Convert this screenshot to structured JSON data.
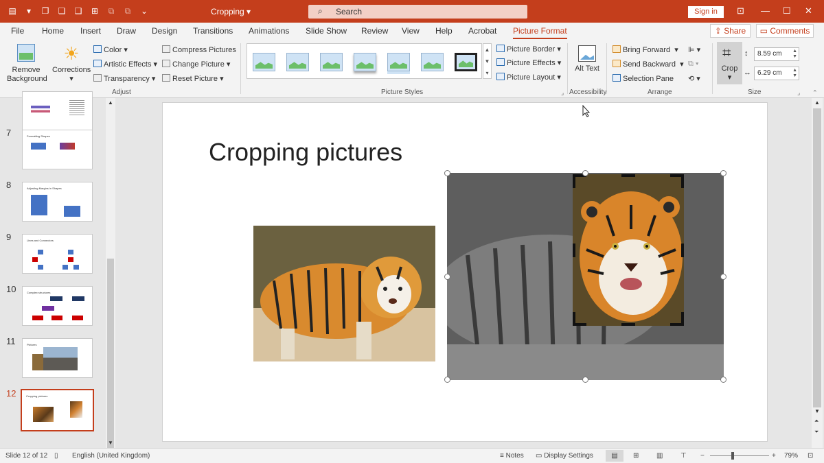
{
  "window": {
    "doc_title": "Cropping",
    "search_placeholder": "Search",
    "sign_in": "Sign in"
  },
  "tabs": [
    "File",
    "Home",
    "Insert",
    "Draw",
    "Design",
    "Transitions",
    "Animations",
    "Slide Show",
    "Review",
    "View",
    "Help",
    "Acrobat",
    "Picture Format"
  ],
  "header_buttons": {
    "share": "Share",
    "comments": "Comments"
  },
  "ribbon": {
    "adjust": {
      "label": "Adjust",
      "remove_background": "Remove Background",
      "corrections": "Corrections",
      "color": "Color",
      "artistic_effects": "Artistic Effects",
      "transparency": "Transparency",
      "compress_pictures": "Compress Pictures",
      "change_picture": "Change Picture",
      "reset_picture": "Reset Picture"
    },
    "picture_styles": {
      "label": "Picture Styles",
      "picture_border": "Picture Border",
      "picture_effects": "Picture Effects",
      "picture_layout": "Picture Layout"
    },
    "accessibility": {
      "label": "Accessibility",
      "alt_text": "Alt Text"
    },
    "arrange": {
      "label": "Arrange",
      "bring_forward": "Bring Forward",
      "send_backward": "Send Backward",
      "selection_pane": "Selection Pane"
    },
    "size": {
      "label": "Size",
      "crop": "Crop",
      "height": "8.59 cm",
      "width": "6.29 cm"
    }
  },
  "thumbnails": [
    {
      "num": "7",
      "title": "Formatting Shapes"
    },
    {
      "num": "8",
      "title": "Adjusting Margins in Shapes"
    },
    {
      "num": "9",
      "title": "Lines and Connectors"
    },
    {
      "num": "10",
      "title": "Complex structures"
    },
    {
      "num": "11",
      "title": "Pictures"
    },
    {
      "num": "12",
      "title": "Cropping pictures"
    }
  ],
  "slide": {
    "title": "Cropping pictures"
  },
  "status": {
    "slide_count": "Slide 12 of 12",
    "language": "English (United Kingdom)",
    "notes": "Notes",
    "display_settings": "Display Settings",
    "zoom": "79%"
  },
  "colors": {
    "accent": "#c43e1c",
    "titlebar": "#c43e1c"
  }
}
